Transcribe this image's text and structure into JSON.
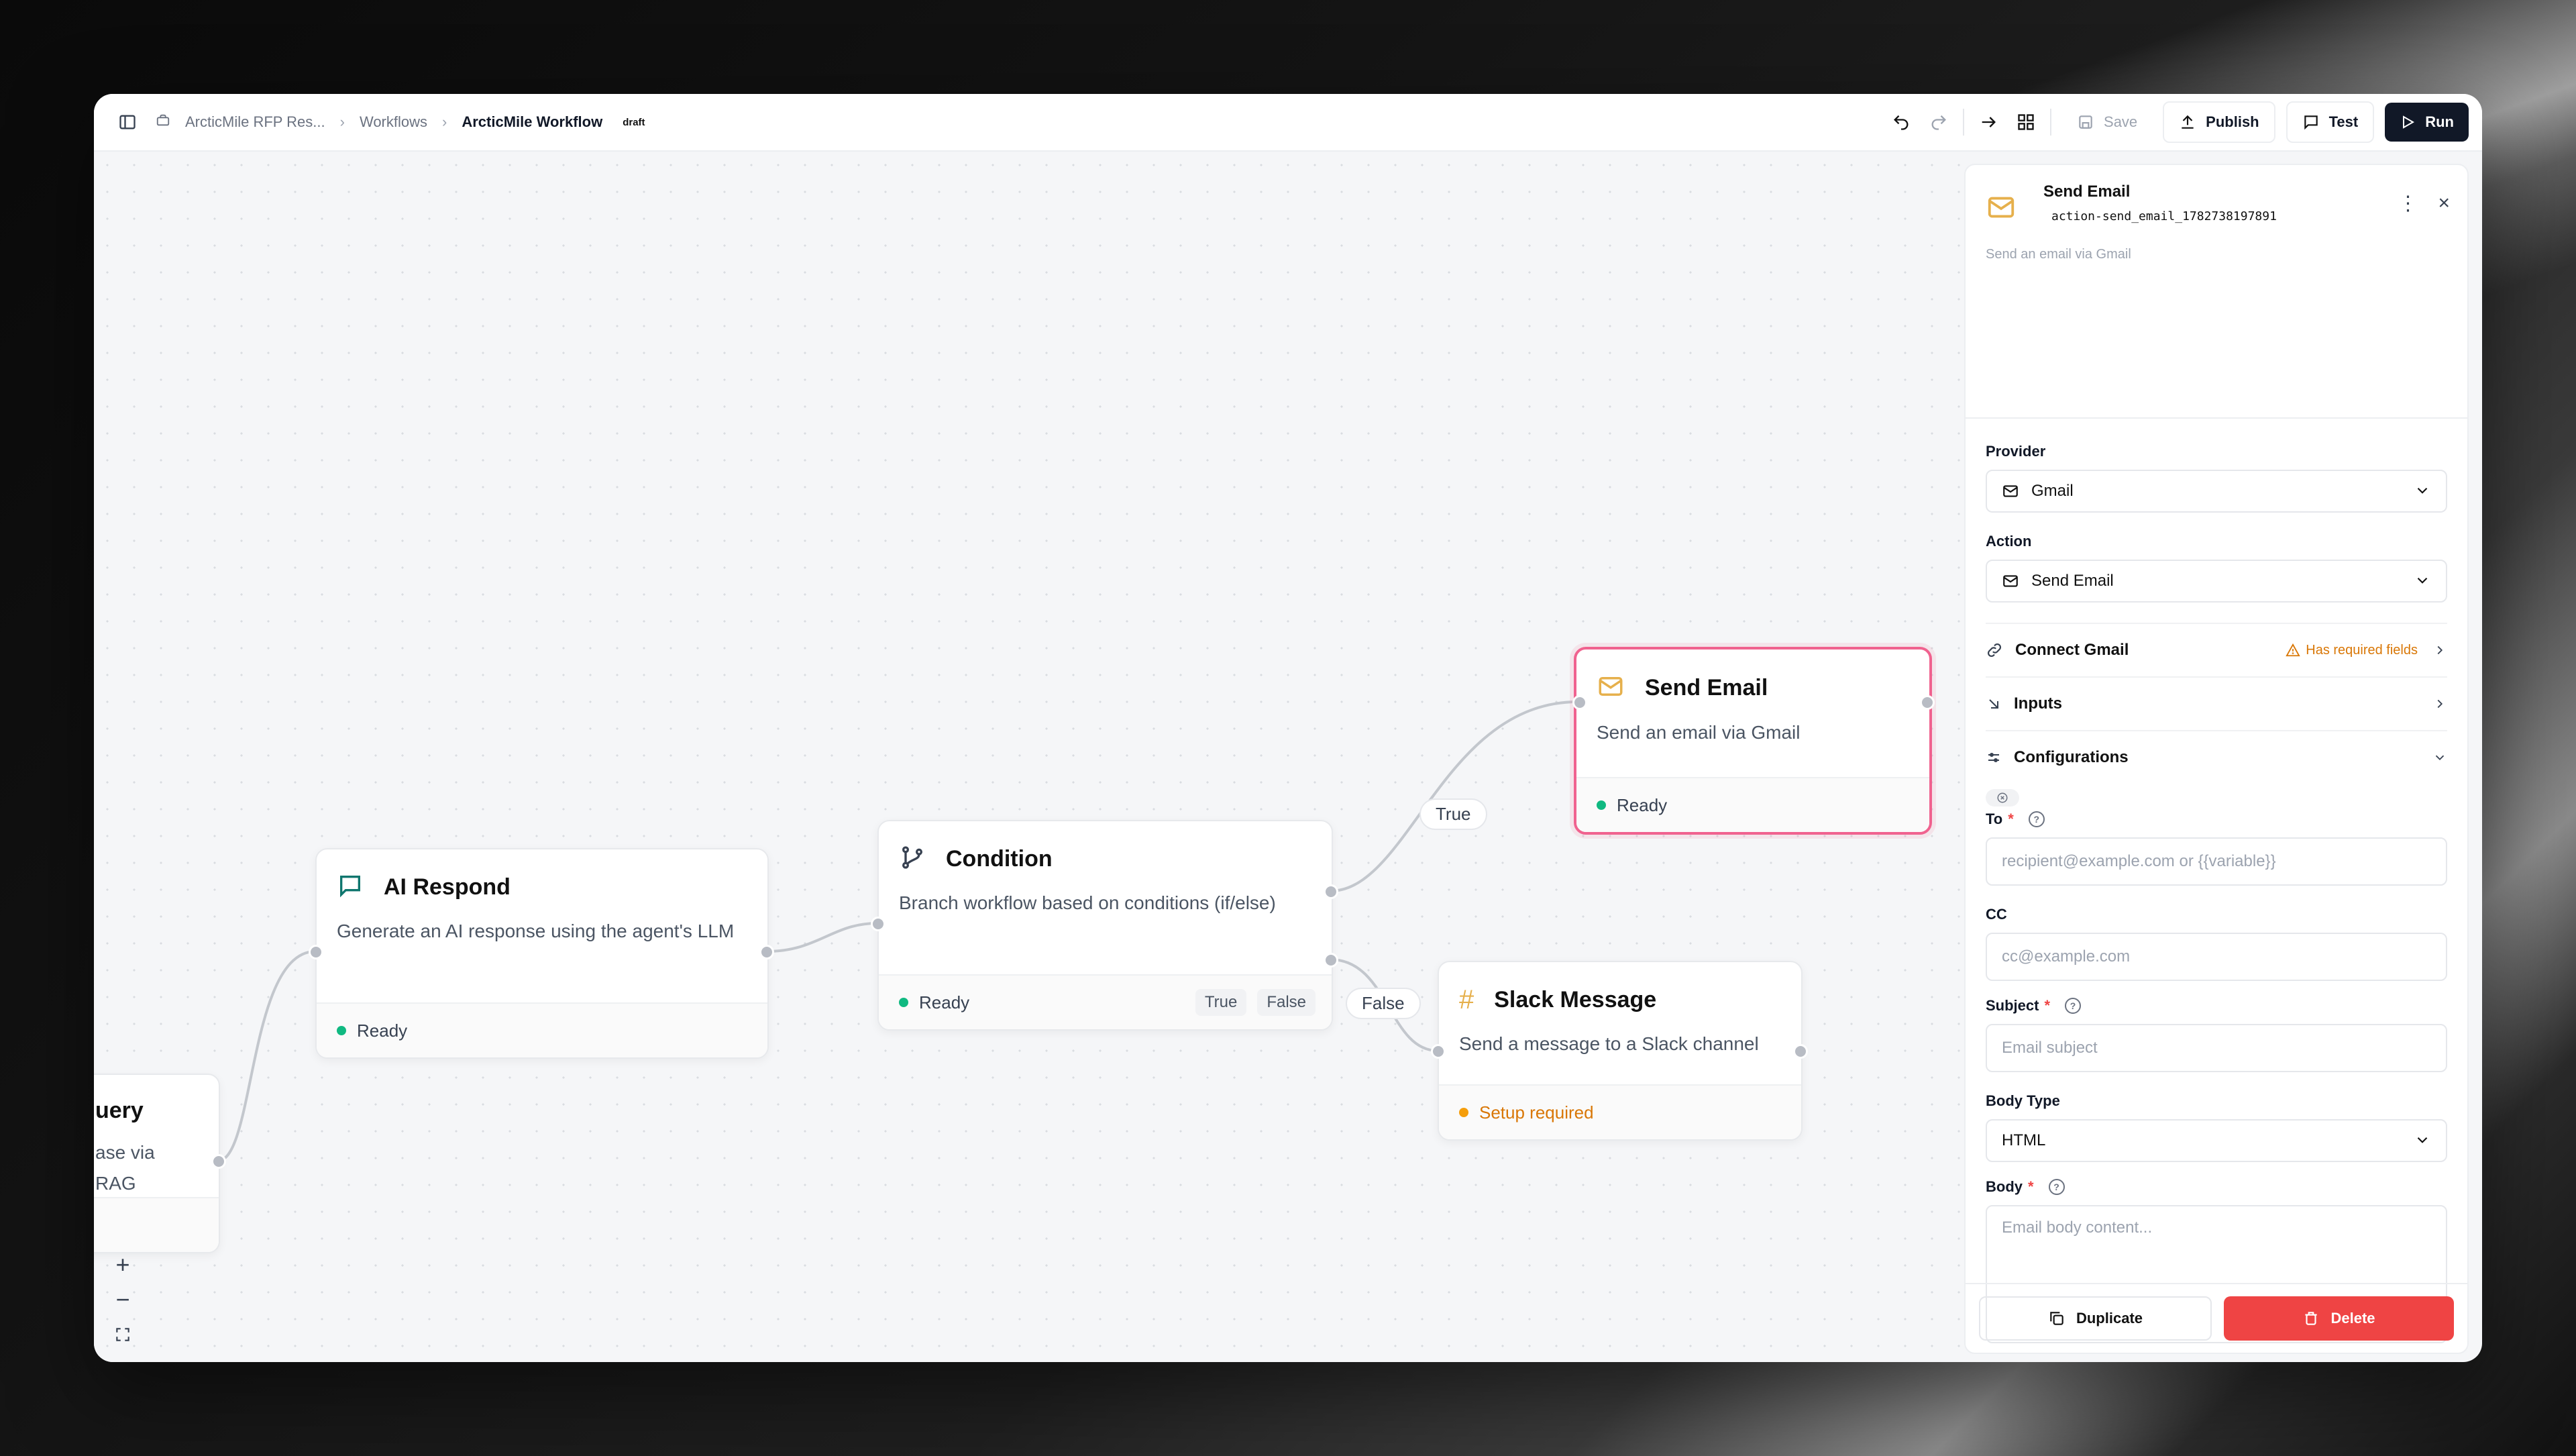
{
  "colors": {
    "accent": "#111827",
    "danger": "#ef4444",
    "ready": "#10b981",
    "warning": "#f59e0b",
    "selected_border": "#f0628f"
  },
  "breadcrumb": {
    "project": "ArcticMile RFP Res...",
    "workflows": "Workflows",
    "current": "ArcticMile Workflow",
    "badge": "draft"
  },
  "toolbar": {
    "save": "Save",
    "publish": "Publish",
    "test": "Test",
    "run": "Run"
  },
  "nodes": {
    "query": {
      "title": "uery",
      "desc": "ase via RAG"
    },
    "ai_respond": {
      "title": "AI Respond",
      "desc": "Generate an AI response using the agent's LLM",
      "status": "Ready"
    },
    "condition": {
      "title": "Condition",
      "desc": "Branch workflow based on conditions (if/else)",
      "status": "Ready",
      "true_tag": "True",
      "false_tag": "False"
    },
    "send_email": {
      "title": "Send Email",
      "desc": "Send an email via Gmail",
      "status": "Ready"
    },
    "slack": {
      "title": "Slack Message",
      "desc": "Send a message to a Slack channel",
      "status": "Setup required"
    }
  },
  "edge_labels": {
    "true_label": "True",
    "false_label": "False"
  },
  "panel": {
    "title": "Send Email",
    "id": "action-send_email_1782738197891",
    "desc": "Send an email via Gmail",
    "provider_label": "Provider",
    "provider_value": "Gmail",
    "action_label": "Action",
    "action_value": "Send Email",
    "connect": "Connect Gmail",
    "connect_warning": "Has required fields",
    "inputs": "Inputs",
    "configurations": "Configurations",
    "to_label": "To",
    "to_placeholder": "recipient@example.com or {{variable}}",
    "cc_label": "CC",
    "cc_placeholder": "cc@example.com",
    "subject_label": "Subject",
    "subject_placeholder": "Email subject",
    "body_type_label": "Body Type",
    "body_type_value": "HTML",
    "body_label": "Body",
    "body_placeholder": "Email body content...",
    "duplicate": "Duplicate",
    "delete": "Delete"
  }
}
